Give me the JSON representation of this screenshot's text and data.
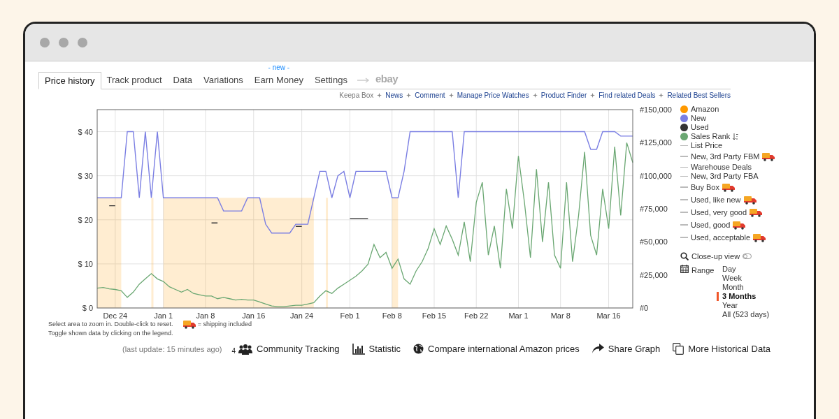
{
  "tabs": [
    {
      "label": "Price history",
      "selected": true
    },
    {
      "label": "Track product",
      "selected": false
    },
    {
      "label": "Data",
      "selected": false
    },
    {
      "label": "Variations",
      "selected": false
    },
    {
      "label": "Earn Money",
      "selected": false,
      "badge": "- new -"
    },
    {
      "label": "Settings",
      "selected": false
    }
  ],
  "ebay_link": "ebay",
  "links": [
    {
      "label": "Keepa Box",
      "kind": "plain"
    },
    {
      "label": "News",
      "kind": "link"
    },
    {
      "label": "Comment",
      "kind": "link"
    },
    {
      "label": "Manage Price Watches",
      "kind": "link"
    },
    {
      "label": "Product Finder",
      "kind": "link"
    },
    {
      "label": "Find related Deals",
      "kind": "link"
    },
    {
      "label": "Related Best Sellers",
      "kind": "link"
    }
  ],
  "chart_data": {
    "type": "line",
    "grid": true,
    "categories": [
      null,
      null,
      null,
      "Dec 24",
      null,
      null,
      null,
      null,
      null,
      null,
      null,
      "Jan 1",
      null,
      null,
      null,
      null,
      null,
      null,
      "Jan 8",
      null,
      null,
      null,
      null,
      null,
      null,
      null,
      "Jan 16",
      null,
      null,
      null,
      null,
      null,
      null,
      null,
      "Jan 24",
      null,
      null,
      null,
      null,
      null,
      null,
      null,
      "Feb 1",
      null,
      null,
      null,
      null,
      null,
      null,
      "Feb 8",
      null,
      null,
      null,
      null,
      null,
      null,
      "Feb 15",
      null,
      null,
      null,
      null,
      null,
      null,
      "Feb 22",
      null,
      null,
      null,
      null,
      null,
      null,
      "Mar 1",
      null,
      null,
      null,
      null,
      null,
      null,
      "Mar 8",
      null,
      null,
      null,
      null,
      null,
      null,
      null,
      "Mar 16",
      null,
      null,
      null,
      null
    ],
    "ylim": [
      0,
      45
    ],
    "yticks": [
      {
        "value": 0,
        "label": "$ 0"
      },
      {
        "value": 10,
        "label": "$ 10"
      },
      {
        "value": 20,
        "label": "$ 20"
      },
      {
        "value": 30,
        "label": "$ 30"
      },
      {
        "value": 40,
        "label": "$ 40"
      }
    ],
    "y2lim": [
      0,
      150000
    ],
    "y2ticks": [
      {
        "value": 0,
        "label": "#0"
      },
      {
        "value": 25000,
        "label": "#25,000"
      },
      {
        "value": 50000,
        "label": "#50,000"
      },
      {
        "value": 75000,
        "label": "#75,000"
      },
      {
        "value": 100000,
        "label": "#100,000"
      },
      {
        "value": 125000,
        "label": "#125,000"
      },
      {
        "value": 150000,
        "label": "#150,000"
      }
    ],
    "series": [
      {
        "name": "Amazon",
        "color": "#ff9900",
        "type": "area",
        "values": [
          25,
          25,
          25,
          25,
          25,
          null,
          null,
          null,
          null,
          25,
          null,
          25,
          25,
          25,
          25,
          25,
          25,
          25,
          25,
          25,
          25,
          25,
          25,
          25,
          25,
          25,
          25,
          25,
          25,
          25,
          25,
          25,
          25,
          25,
          25,
          25,
          25,
          null,
          25,
          null,
          null,
          null,
          null,
          null,
          null,
          null,
          null,
          null,
          null,
          25,
          25,
          null,
          null,
          null,
          null,
          null,
          null,
          null,
          null,
          null,
          null,
          null,
          null,
          null,
          null,
          null,
          null,
          null,
          null,
          null,
          null,
          null,
          null,
          null,
          null,
          null,
          null,
          null,
          null,
          null,
          null,
          null,
          null,
          null,
          null,
          null,
          null,
          null,
          null,
          null
        ]
      },
      {
        "name": "New",
        "color": "#7b7fe3",
        "values": [
          25,
          25,
          25,
          25,
          25,
          40,
          40,
          25,
          40,
          25,
          40,
          25,
          25,
          25,
          25,
          25,
          25,
          25,
          25,
          25,
          25,
          22,
          22,
          22,
          22,
          25,
          25,
          25,
          19,
          17,
          17,
          17,
          17,
          19,
          19,
          19,
          25,
          31,
          31,
          25,
          30,
          31,
          25,
          31,
          31,
          31,
          31,
          31,
          31,
          25,
          25,
          31,
          40,
          40,
          40,
          40,
          40,
          40,
          40,
          40,
          25,
          40,
          40,
          40,
          40,
          40,
          40,
          40,
          40,
          40,
          40,
          40,
          40,
          40,
          40,
          40,
          40,
          40,
          40,
          40,
          40,
          40,
          36,
          36,
          40,
          40,
          40,
          39,
          39,
          39
        ]
      },
      {
        "name": "Used",
        "color": "#333333",
        "values": [
          null,
          null,
          23.2,
          23.2,
          null,
          null,
          null,
          null,
          null,
          null,
          null,
          null,
          null,
          null,
          null,
          null,
          null,
          null,
          null,
          19.3,
          19.3,
          null,
          null,
          null,
          null,
          null,
          null,
          null,
          null,
          null,
          null,
          null,
          null,
          18.5,
          18.5,
          null,
          null,
          null,
          null,
          null,
          null,
          null,
          20.3,
          20.3,
          20.3,
          20.3,
          null,
          null,
          null,
          null,
          null,
          null,
          null,
          null,
          null,
          null,
          null,
          null,
          null,
          null,
          null,
          null,
          null,
          null,
          null,
          null,
          null,
          null,
          null,
          null,
          null,
          null,
          null,
          null,
          null,
          null,
          null,
          null,
          null,
          null,
          null,
          null,
          null,
          null,
          null,
          null,
          null,
          null,
          null,
          null
        ]
      },
      {
        "name": "Sales Rank",
        "color": "#6aa772",
        "axis": "y2",
        "values": [
          15000,
          15500,
          14500,
          14000,
          13000,
          8000,
          12000,
          18000,
          22000,
          26000,
          22000,
          20000,
          16000,
          14000,
          12000,
          14000,
          11000,
          10000,
          9000,
          9000,
          7000,
          8000,
          7000,
          6000,
          6500,
          6000,
          6000,
          4500,
          3000,
          1500,
          1000,
          1000,
          1500,
          2000,
          2000,
          3000,
          4000,
          9000,
          13000,
          11000,
          15000,
          18000,
          21000,
          24000,
          28000,
          33000,
          48000,
          38000,
          42000,
          30000,
          37000,
          22000,
          18000,
          28000,
          35000,
          45000,
          60000,
          48000,
          62000,
          52000,
          40000,
          65000,
          35000,
          80000,
          95000,
          40000,
          62000,
          30000,
          90000,
          60000,
          115000,
          80000,
          38000,
          105000,
          50000,
          95000,
          40000,
          30000,
          95000,
          35000,
          70000,
          118000,
          55000,
          40000,
          90000,
          60000,
          122000,
          70000,
          125000,
          110000
        ]
      }
    ]
  },
  "legend": [
    {
      "label": "List Price",
      "shipping": false
    },
    {
      "label": "New, 3rd Party FBM",
      "shipping": true
    },
    {
      "label": "Warehouse Deals",
      "shipping": false
    },
    {
      "label": "New, 3rd Party FBA",
      "shipping": false
    },
    {
      "label": "Buy Box",
      "shipping": true
    },
    {
      "label": "Used, like new",
      "shipping": true
    },
    {
      "label": "Used, very good",
      "shipping": true
    },
    {
      "label": "Used, good",
      "shipping": true
    },
    {
      "label": "Used, acceptable",
      "shipping": true
    }
  ],
  "close_up": {
    "label": "Close-up view",
    "on": false
  },
  "range": {
    "label": "Range",
    "options": [
      {
        "label": "Day",
        "selected": false
      },
      {
        "label": "Week",
        "selected": false
      },
      {
        "label": "Month",
        "selected": false
      },
      {
        "label": "3 Months",
        "selected": true
      },
      {
        "label": "Year",
        "selected": false
      },
      {
        "label": "All (523 days)",
        "selected": false
      }
    ]
  },
  "notes": [
    "Select area to zoom in. Double-click to reset.",
    "Toggle shown data by clicking on the legend."
  ],
  "shipping_note": "= shipping included",
  "last_update": "(last update: 15 minutes ago)",
  "actions": [
    {
      "kind": "community",
      "count": "4",
      "label": "Community Tracking"
    },
    {
      "kind": "statistic",
      "label": "Statistic"
    },
    {
      "kind": "globe",
      "label": "Compare international Amazon prices"
    },
    {
      "kind": "share",
      "label": "Share Graph"
    },
    {
      "kind": "copy",
      "label": "More Historical Data"
    }
  ]
}
